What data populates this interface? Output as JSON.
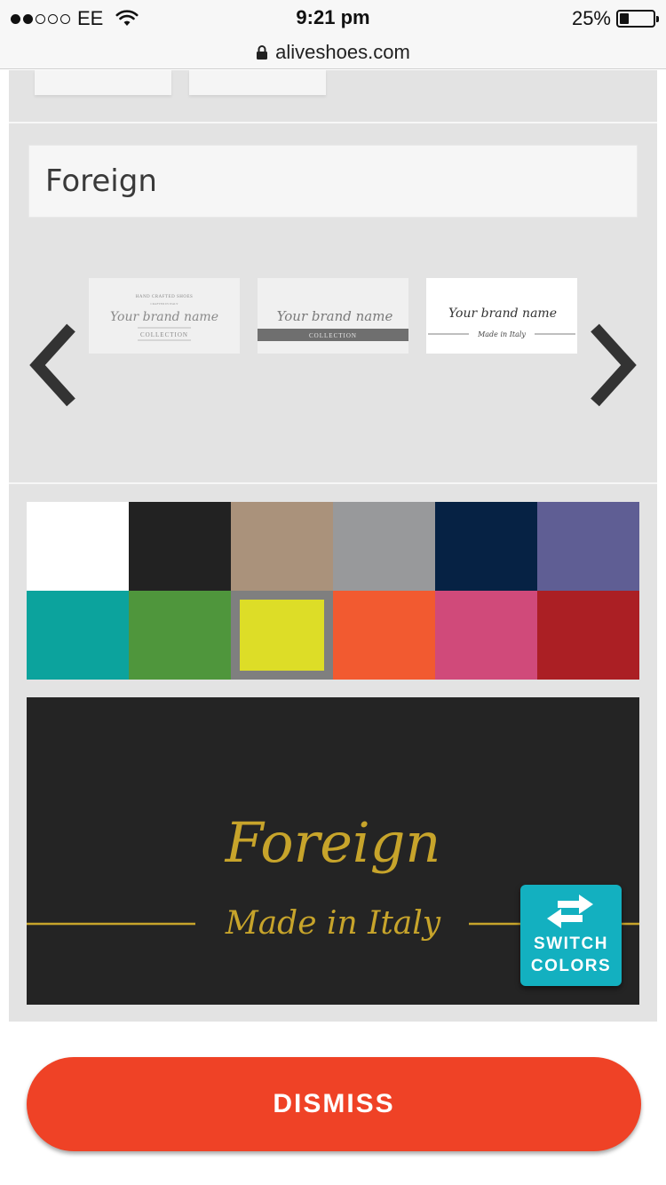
{
  "status_bar": {
    "carrier": "EE",
    "time": "9:21 pm",
    "battery": "25%",
    "battery_level": 0.25,
    "signal_bars_filled": 2,
    "signal_bars_total": 5
  },
  "browser": {
    "url": "aliveshoes.com",
    "lock_icon": "lock-icon"
  },
  "editor": {
    "brand_name_value": "Foreign",
    "prev_icon": "chevron-left-icon",
    "next_icon": "chevron-right-icon",
    "logo_styles": [
      {
        "top_text": "HAND CRAFTED SHOES",
        "small_text": "CRAFTED IN ITALY",
        "brand_text": "Your brand name",
        "bottom_text": "COLLECTION"
      },
      {
        "brand_text": "Your brand name",
        "band_text": "COLLECTION"
      },
      {
        "brand_text": "Your brand name",
        "sub_text": "Made in Italy"
      }
    ]
  },
  "colors": {
    "swatches": [
      {
        "name": "white",
        "hex": "#ffffff"
      },
      {
        "name": "black",
        "hex": "#222222"
      },
      {
        "name": "taupe",
        "hex": "#aa927b"
      },
      {
        "name": "gray",
        "hex": "#98999b"
      },
      {
        "name": "navy",
        "hex": "#062244"
      },
      {
        "name": "purple",
        "hex": "#5f5e94"
      },
      {
        "name": "teal",
        "hex": "#0ca39d"
      },
      {
        "name": "green",
        "hex": "#4f963c"
      },
      {
        "name": "yellow",
        "hex": "#dddd27"
      },
      {
        "name": "orange",
        "hex": "#f25a30"
      },
      {
        "name": "pink",
        "hex": "#d04a7a"
      },
      {
        "name": "red",
        "hex": "#ab1f24"
      }
    ],
    "selected_index": 8
  },
  "preview": {
    "brand_text": "Foreign",
    "sub_text": "Made in Italy",
    "text_color": "#c7a42b",
    "background": "#242424",
    "switch_label_line1": "SWITCH",
    "switch_label_line2": "COLORS",
    "switch_icon": "swap-arrows-icon"
  },
  "actions": {
    "dismiss_label": "DISMISS",
    "dismiss_color": "#ef4226"
  }
}
